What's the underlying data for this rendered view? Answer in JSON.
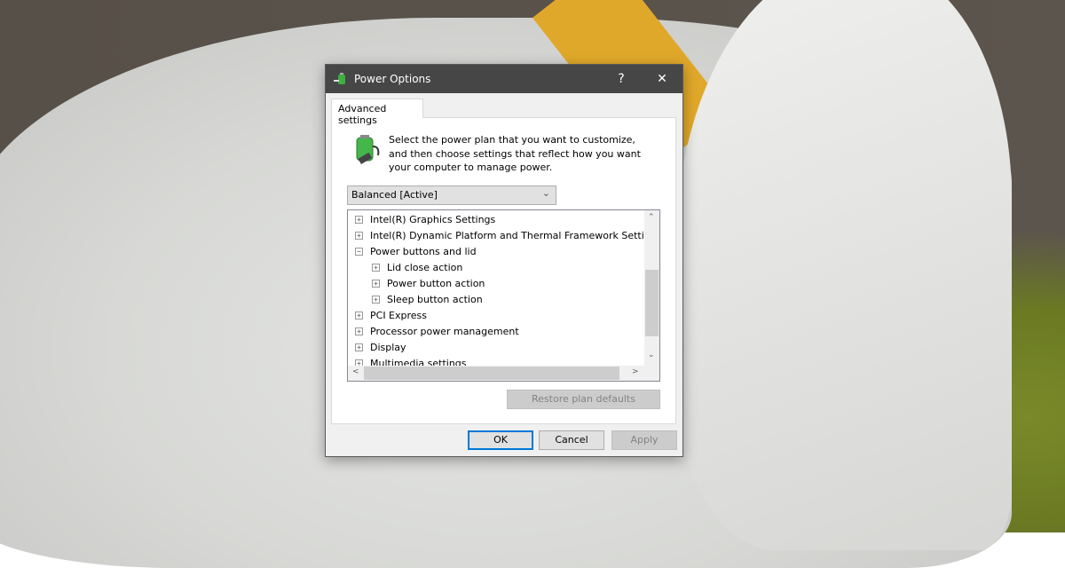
{
  "window": {
    "title": "Power Options",
    "help_label": "?",
    "close_label": "✕"
  },
  "tab": {
    "label": "Advanced settings"
  },
  "description": "Select the power plan that you want to customize, and then choose settings that reflect how you want your computer to manage power.",
  "plan_select": {
    "value": "Balanced [Active]"
  },
  "tree": [
    {
      "label": "Intel(R) Graphics Settings",
      "level": 0,
      "expanded": false
    },
    {
      "label": "Intel(R) Dynamic Platform and Thermal Framework Settings",
      "level": 0,
      "expanded": false
    },
    {
      "label": "Power buttons and lid",
      "level": 0,
      "expanded": true
    },
    {
      "label": "Lid close action",
      "level": 1,
      "expanded": false
    },
    {
      "label": "Power button action",
      "level": 1,
      "expanded": false
    },
    {
      "label": "Sleep button action",
      "level": 1,
      "expanded": false
    },
    {
      "label": "PCI Express",
      "level": 0,
      "expanded": false
    },
    {
      "label": "Processor power management",
      "level": 0,
      "expanded": false
    },
    {
      "label": "Display",
      "level": 0,
      "expanded": false
    },
    {
      "label": "Multimedia settings",
      "level": 0,
      "expanded": false
    }
  ],
  "buttons": {
    "restore": "Restore plan defaults",
    "ok": "OK",
    "cancel": "Cancel",
    "apply": "Apply"
  },
  "colors": {
    "titlebar": "#464646",
    "focus": "#0078d7"
  }
}
